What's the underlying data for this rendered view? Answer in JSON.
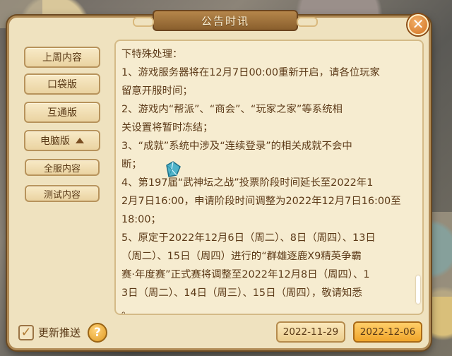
{
  "dialog": {
    "title": "公告时讯",
    "close_glyph": "✕"
  },
  "sidebar": {
    "items": [
      {
        "label": "上周内容"
      },
      {
        "label": "口袋版"
      },
      {
        "label": "互通版"
      },
      {
        "label": "电脑版"
      },
      {
        "label": "全服内容"
      },
      {
        "label": "测试内容"
      }
    ]
  },
  "content": {
    "lines": [
      "下特殊处理：",
      "1、游戏服务器将在12月7日00:00重新开启，请各位玩家",
      "留意开服时间；",
      "2、游戏内“帮派”、“商会”、“玩家之家”等系统相",
      "关设置将暂时冻结；",
      "3、“成就”系统中涉及“连续登录”的相关成就不会中",
      "断；",
      "4、第197届“武神坛之战”投票阶段时间延长至2022年1",
      "2月7日16:00，申请阶段时间调整为2022年12月7日16:00至",
      "18:00；",
      "5、原定于2022年12月6日（周二）、8日（周四）、13日",
      "（周二）、15日（周四）进行的“群雄逐鹿X9精英争霸",
      "赛·年度赛”正式赛将调整至2022年12月8日（周四）、1",
      "3日（周二）、14日（周三）、15日（周四），敬请知悉",
      "。"
    ]
  },
  "footer": {
    "checkbox_checked": true,
    "checkbox_glyph": "✓",
    "checkbox_label": "更新推送",
    "help_glyph": "?",
    "dates": [
      {
        "label": "2022-11-29",
        "active": false
      },
      {
        "label": "2022-12-06",
        "active": true
      }
    ]
  },
  "colors": {
    "panel": "#efe2bf",
    "text": "#5c3a18",
    "accent": "#f0a52a"
  },
  "icons": [
    "close-icon",
    "chevron-up-icon",
    "gem-icon",
    "check-icon",
    "help-icon"
  ]
}
